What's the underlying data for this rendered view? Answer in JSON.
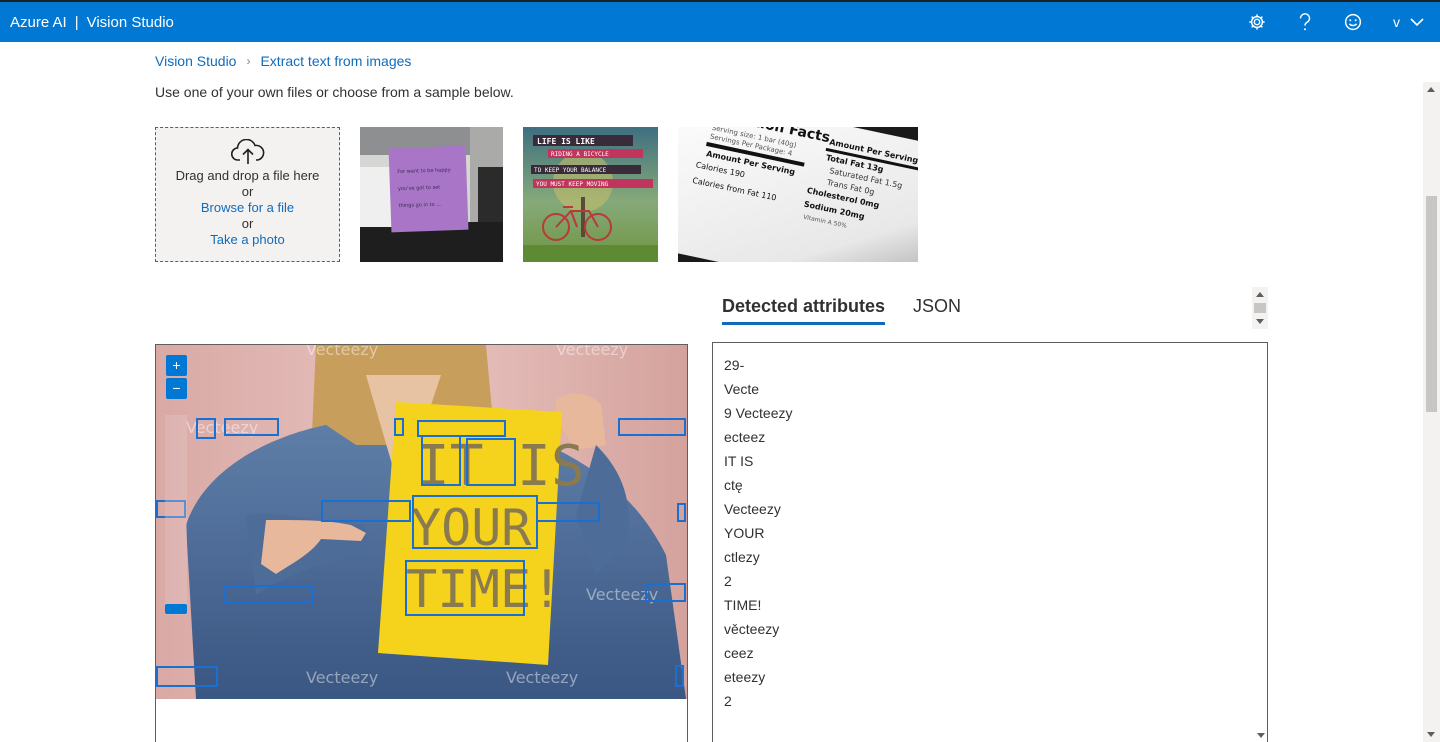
{
  "app": {
    "brand": "Azure AI",
    "separator": "|",
    "product": "Vision Studio",
    "account_initial": "v"
  },
  "header_icons": [
    "gear-icon",
    "help-icon",
    "feedback-smiley-icon",
    "chevron-down-icon"
  ],
  "breadcrumb": {
    "root": "Vision Studio",
    "current": "Extract text from images"
  },
  "intro": "Use one of your own files or choose from a sample below.",
  "upload": {
    "drag_text": "Drag and drop a file here",
    "or1": "or",
    "browse": "Browse for a file",
    "or2": "or",
    "photo": "Take a photo"
  },
  "samples": {
    "note": [
      "For want to be happy",
      "you've got to set",
      "things go in to ..."
    ],
    "bicycle": [
      "LIFE IS LIKE",
      "RIDING A BICYCLE",
      "TO KEEP YOUR BALANCE",
      "YOU MUST KEEP MOVING"
    ],
    "nutrition": [
      "Nutrition Facts",
      "Serving size: 1 bar (40g)",
      "Servings Per Package: 4",
      "Amount Per Serving",
      "Calories 190",
      "Calories from Fat 110",
      "Amount Per Serving",
      "Total Fat 13g",
      "Saturated Fat 1.5g",
      "Trans Fat 0g",
      "Cholesterol 0mg",
      "Sodium 20mg",
      "Vitamin A 50%"
    ]
  },
  "analyzed_image": {
    "sign_lines": [
      "IT IS",
      "YOUR",
      "TIME!"
    ],
    "watermark": "Vecteezy"
  },
  "tabs": [
    {
      "label": "Detected attributes",
      "active": true
    },
    {
      "label": "JSON",
      "active": false
    }
  ],
  "results": [
    "29-",
    "Vecte",
    "9 Vecteezy",
    "ecteez",
    "IT IS",
    "ctę",
    "Vecteezy",
    "YOUR",
    "ctlezy",
    "2",
    "TIME!",
    "věcteezy",
    "ceez",
    "eteezy",
    "2"
  ],
  "colors": {
    "accent": "#0078d4",
    "link": "#0f6cbd",
    "bbox": "#1a6fd3",
    "sign": "#f5d21c"
  }
}
